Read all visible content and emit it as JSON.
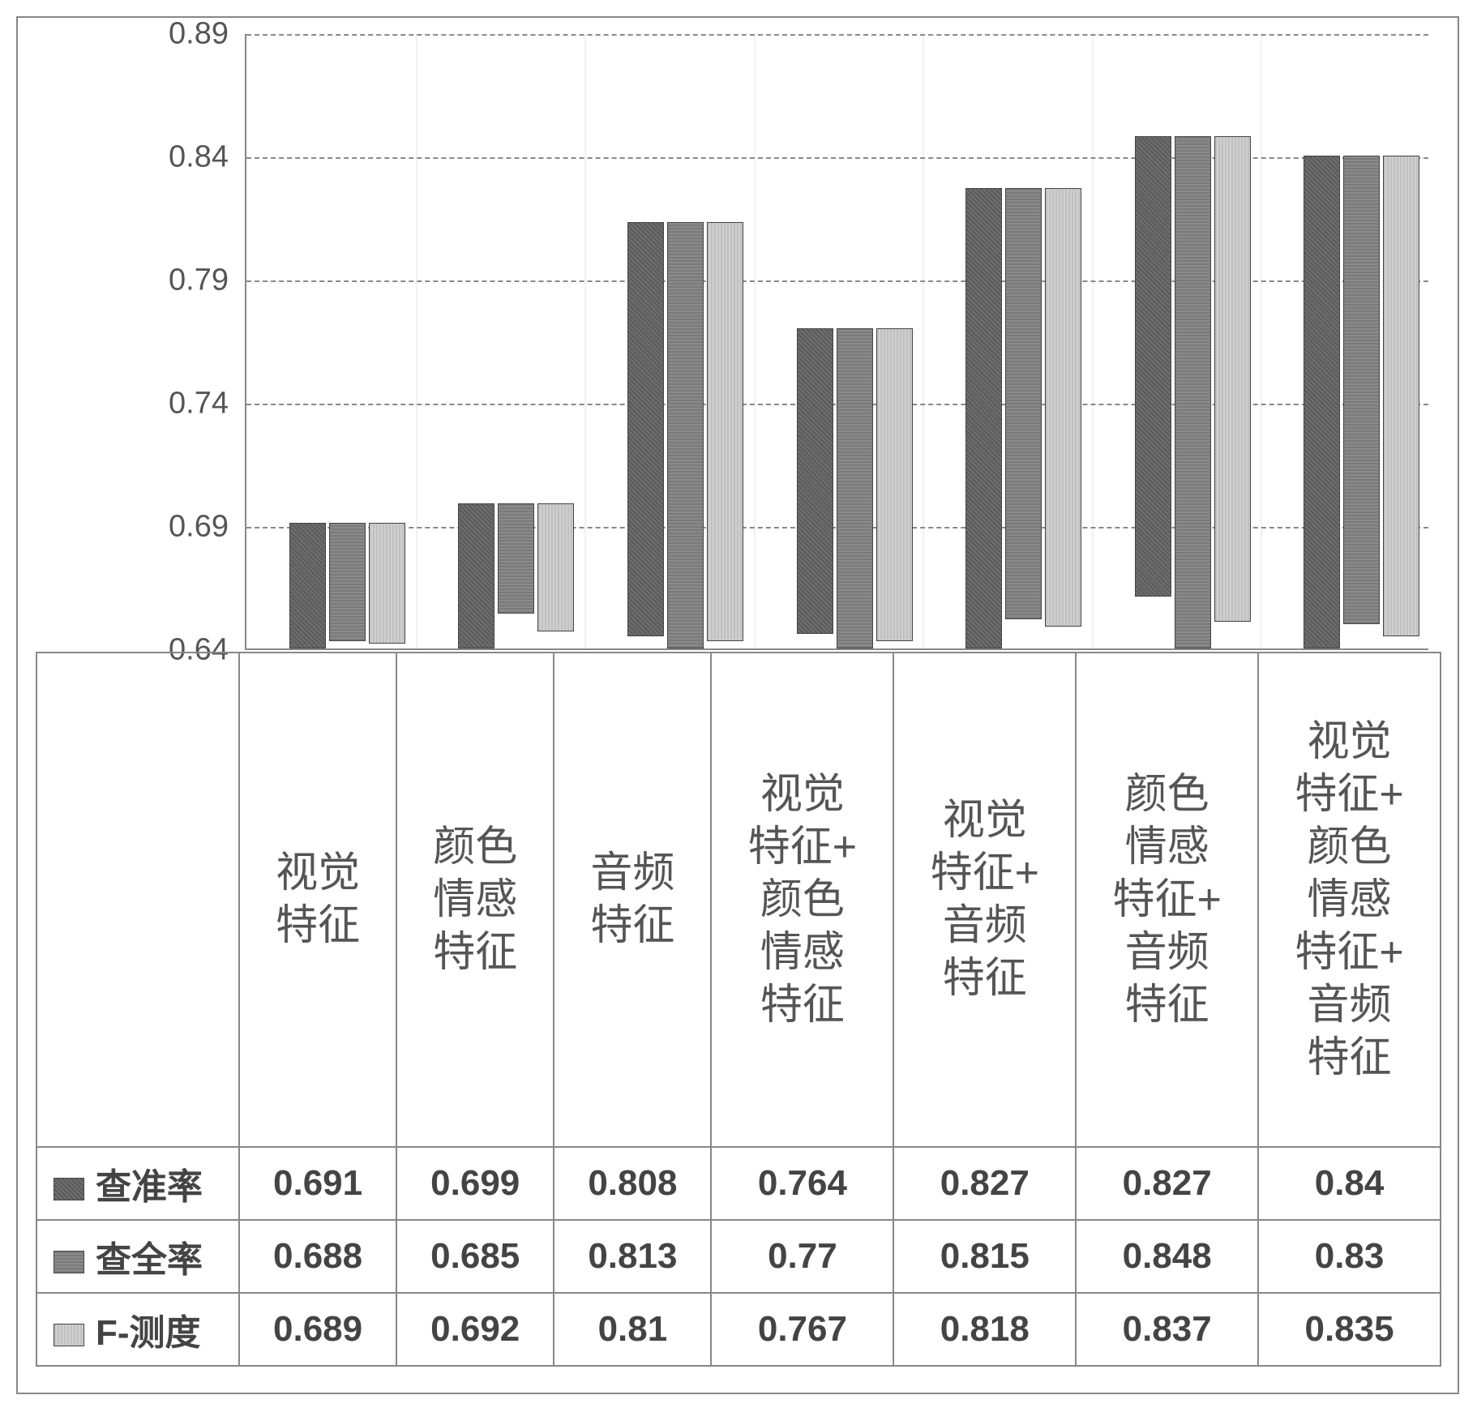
{
  "chart_data": {
    "type": "bar",
    "categories": [
      "视觉特征",
      "颜色情感特征",
      "音频特征",
      "视觉特征+颜色情感特征",
      "视觉特征+音频特征",
      "颜色情感特征+音频特征",
      "视觉特征+颜色情感特征+音频特征"
    ],
    "series": [
      {
        "name": "查准率",
        "values": [
          0.691,
          0.699,
          0.808,
          0.764,
          0.827,
          0.827,
          0.84
        ]
      },
      {
        "name": "查全率",
        "values": [
          0.688,
          0.685,
          0.813,
          0.77,
          0.815,
          0.848,
          0.83
        ]
      },
      {
        "name": "F-测度",
        "values": [
          0.689,
          0.692,
          0.81,
          0.767,
          0.818,
          0.837,
          0.835
        ]
      }
    ],
    "ylim": [
      0.64,
      0.89
    ],
    "yticks": [
      0.64,
      0.69,
      0.74,
      0.79,
      0.84,
      0.89
    ],
    "title": "",
    "xlabel": "",
    "ylabel": ""
  },
  "category_labels_wrapped": [
    "视觉\n特征",
    "颜色\n情感\n特征",
    "音频\n特征",
    "视觉\n特征+\n颜色\n情感\n特征",
    "视觉\n特征+\n音频\n特征",
    "颜色\n情感\n特征+\n音频\n特征",
    "视觉\n特征+\n颜色\n情感\n特征+\n音频\n特征"
  ]
}
